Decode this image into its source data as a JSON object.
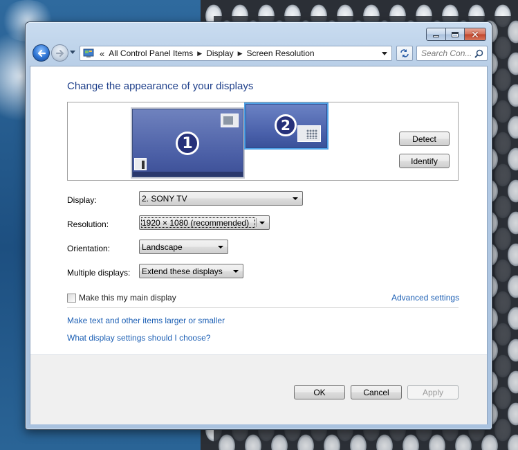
{
  "window": {
    "caption_buttons": [
      "minimize-icon",
      "maximize-icon",
      "close-icon"
    ],
    "close_glyph": "✕"
  },
  "navbar": {
    "address": {
      "prefix": "«",
      "crumbs": [
        "All Control Panel Items",
        "Display",
        "Screen Resolution"
      ],
      "separator": "▶"
    },
    "search_placeholder": "Search Con..."
  },
  "page": {
    "title": "Change the appearance of your displays",
    "monitors": [
      {
        "number": "1",
        "selected": false
      },
      {
        "number": "2",
        "selected": true
      }
    ],
    "detect_label": "Detect",
    "identify_label": "Identify",
    "display": {
      "label": "Display:",
      "value": "2. SONY TV"
    },
    "resolution": {
      "label": "Resolution:",
      "value": "1920 × 1080 (recommended)"
    },
    "orientation": {
      "label": "Orientation:",
      "value": "Landscape"
    },
    "multiple": {
      "label": "Multiple displays:",
      "value": "Extend these displays"
    },
    "main_display": {
      "label": "Make this my main display",
      "checked": false
    },
    "advanced_link": "Advanced settings",
    "text_size_link": "Make text and other items larger or smaller",
    "help_link": "What display settings should I choose?",
    "ok_label": "OK",
    "cancel_label": "Cancel",
    "apply_label": "Apply",
    "apply_enabled": false
  },
  "colors": {
    "title_blue": "#1e3f8a",
    "link_blue": "#1c5fb4",
    "monitor_selected_border": "#4fa1e6"
  }
}
